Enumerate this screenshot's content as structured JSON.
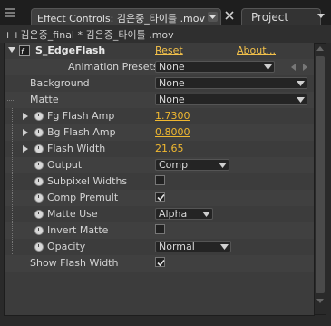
{
  "tabs": [
    {
      "label": "Effect Controls: 김은중_타이틀 .mov"
    },
    {
      "label": "Project"
    }
  ],
  "breadcrumb": "++김은중_final * 김은중_타이틀 .mov",
  "effect": {
    "name": "S_EdgeFlash",
    "reset_label": "Reset",
    "about_label": "About...",
    "icon": "fx-icon"
  },
  "rows": {
    "animation_presets": {
      "label": "Animation Presets:",
      "value": "None"
    },
    "background": {
      "label": "Background",
      "value": "None"
    },
    "matte": {
      "label": "Matte",
      "value": "None"
    },
    "fg_flash_amp": {
      "label": "Fg Flash Amp",
      "value": "1.7300"
    },
    "bg_flash_amp": {
      "label": "Bg Flash Amp",
      "value": "0.8000"
    },
    "flash_width": {
      "label": "Flash Width",
      "value": "21.65"
    },
    "output": {
      "label": "Output",
      "value": "Comp"
    },
    "subpixel_widths": {
      "label": "Subpixel Widths",
      "checked": false
    },
    "comp_premult": {
      "label": "Comp Premult",
      "checked": true
    },
    "matte_use": {
      "label": "Matte Use",
      "value": "Alpha"
    },
    "invert_matte": {
      "label": "Invert Matte",
      "checked": false
    },
    "opacity": {
      "label": "Opacity",
      "value": "Normal"
    },
    "show_flash_width": {
      "label": "Show Flash Width",
      "checked": true
    }
  },
  "colors": {
    "link": "#f2c04a",
    "value": "#f0b830",
    "panel_bg": "#3c3c3c"
  }
}
